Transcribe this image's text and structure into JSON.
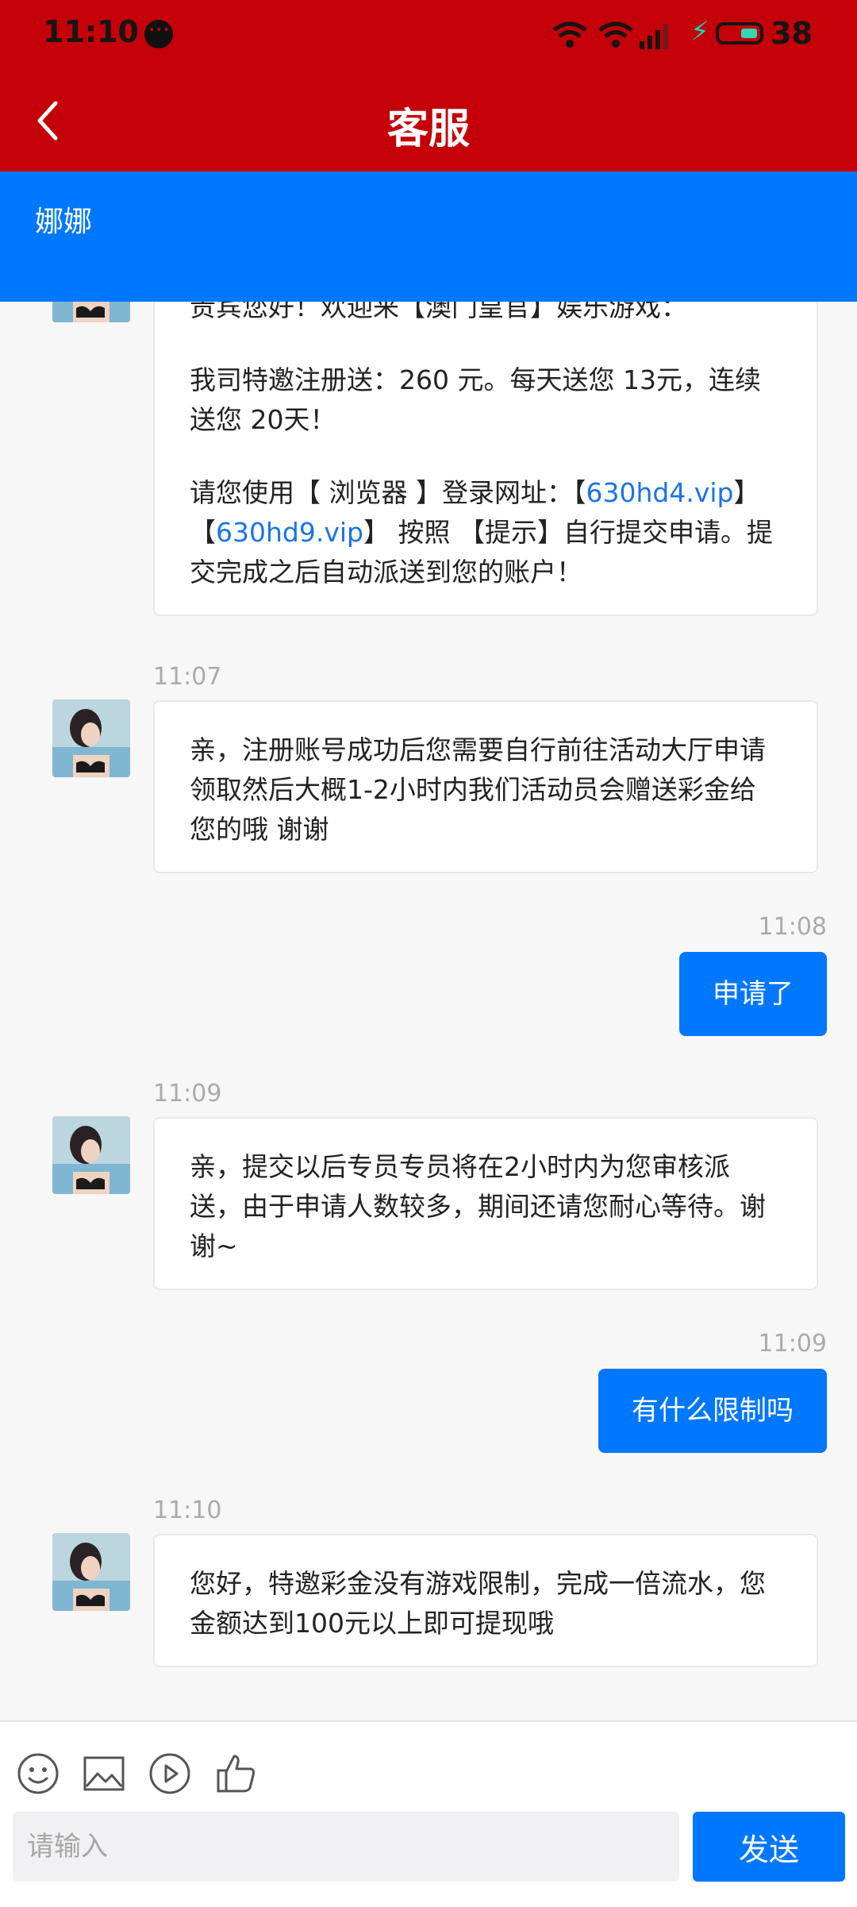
{
  "status_bar": {
    "time": "11:10",
    "battery": "38"
  },
  "header": {
    "title": "客服"
  },
  "agent": {
    "name": "娜娜"
  },
  "messages": {
    "m1": {
      "line1": "贵宾您好！欢迎来【澳门皇官】娱乐游戏：",
      "line2": "我司特邀注册送：260 元。每天送您 13元，连续送您 20天！",
      "p3_prefix": "请您使用【 浏览器 】登录网址：【",
      "link1": "630hd4.vip",
      "p3_mid": "】【",
      "link2": "630hd9.vip",
      "p3_suffix": "】 按照 【提示】自行提交申请。提交完成之后自动派送到您的账户！"
    },
    "m2": {
      "time": "11:07",
      "text": "亲，注册账号成功后您需要自行前往活动大厅申请领取然后大概1-2小时内我们活动员会赠送彩金给您的哦 谢谢"
    },
    "m3": {
      "time": "11:08",
      "text": "申请了"
    },
    "m4": {
      "time": "11:09",
      "text": "亲，提交以后专员专员将在2小时内为您审核派送，由于申请人数较多，期间还请您耐心等待。谢谢~"
    },
    "m5": {
      "time": "11:09",
      "text": "有什么限制吗"
    },
    "m6": {
      "time": "11:10",
      "text": "您好，特邀彩金没有游戏限制，完成一倍流水，您金额达到100元以上即可提现哦"
    }
  },
  "composer": {
    "placeholder": "请输入",
    "send_label": "发送",
    "tools": [
      "emoji-icon",
      "image-icon",
      "video-icon",
      "thumbs-up-icon"
    ]
  },
  "colors": {
    "header_red": "#c40008",
    "accent_blue": "#0077ff",
    "link_blue": "#1a73e8"
  }
}
